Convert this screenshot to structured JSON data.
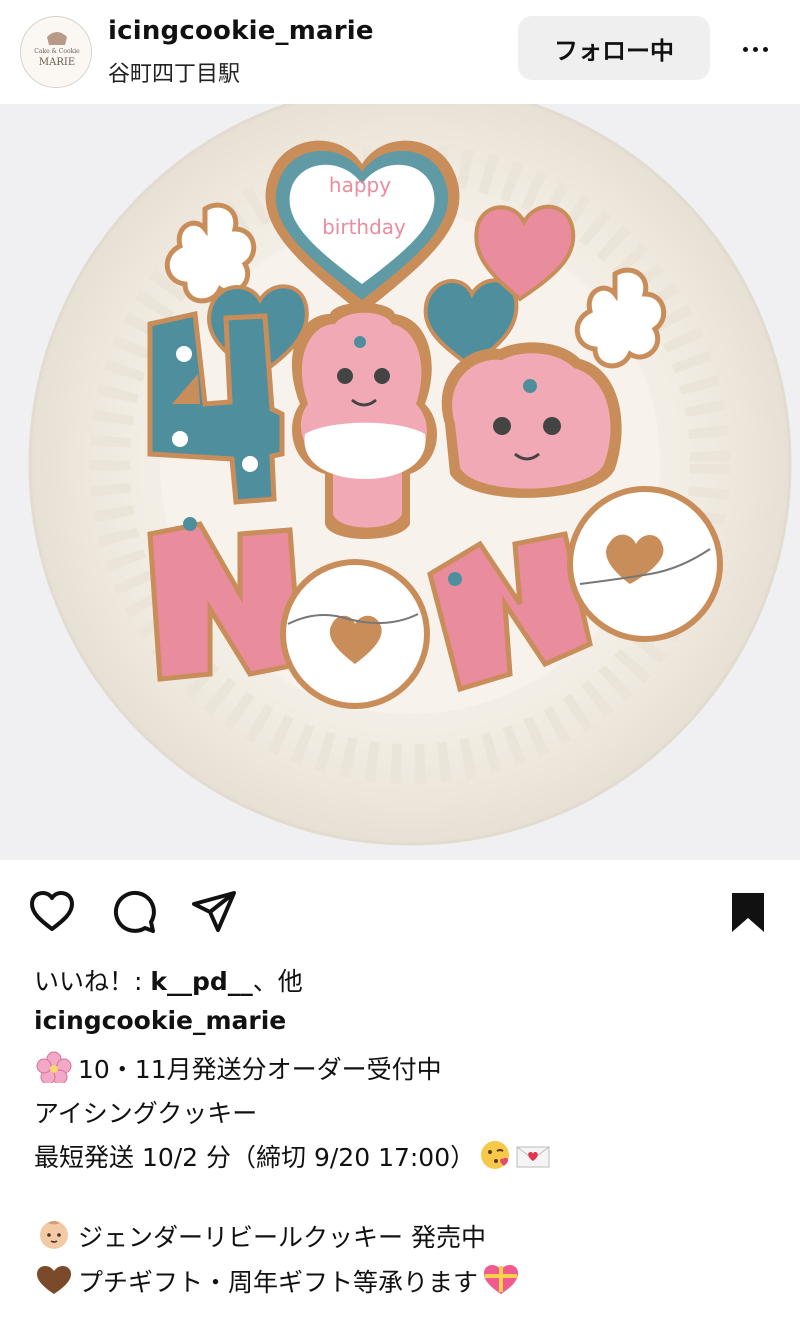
{
  "post": {
    "username": "icingcookie_marie",
    "location": "谷町四丁目駅",
    "follow_label": "フォロー中",
    "avatar_text": {
      "top": "Cake & Cookie",
      "main": "MARIE"
    }
  },
  "photo": {
    "cookie_text": {
      "line1": "happy",
      "line2": "birthday"
    },
    "letters": [
      "4",
      "N",
      "O",
      "N",
      "O"
    ]
  },
  "engagement": {
    "likes_prefix": "いいね！: ",
    "liked_by": "k__pd__",
    "likes_suffix": "、他"
  },
  "caption": {
    "username": "icingcookie_marie",
    "lines": [
      "10・11月発送分オーダー受付中",
      "アイシングクッキー",
      "最短発送 10/2 分（締切 9/20 17:00）",
      "",
      "ジェンダーリビールクッキー 発売中",
      "プチギフト・周年ギフト等承ります"
    ]
  },
  "icons": {
    "line_emojis": [
      "cherry-blossom-icon",
      "kissing-face-icon",
      "love-letter-icon",
      "baby-icon",
      "brown-heart-icon",
      "gift-heart-icon"
    ],
    "actions": [
      "heart-icon",
      "comment-icon",
      "share-icon",
      "bookmark-icon"
    ]
  },
  "colors": {
    "icing_pink": "#e98c9d",
    "icing_teal": "#4f8f9d",
    "icing_white": "#ffffff",
    "cookie_base": "#c98d5a",
    "plate": "#f6f2ea",
    "follow_bg": "#efefef"
  }
}
